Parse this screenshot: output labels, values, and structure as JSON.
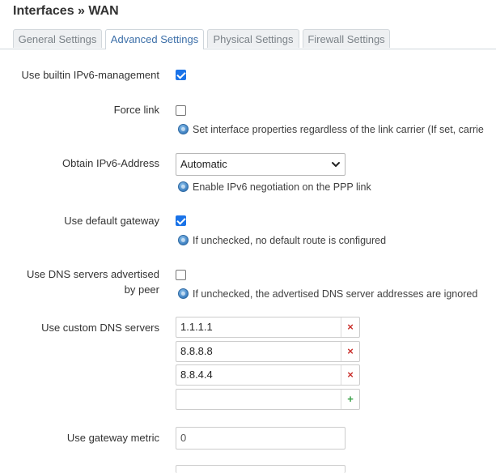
{
  "header": {
    "title": "Interfaces » WAN"
  },
  "tabs": [
    {
      "label": "General Settings",
      "active": false
    },
    {
      "label": "Advanced Settings",
      "active": true
    },
    {
      "label": "Physical Settings",
      "active": false
    },
    {
      "label": "Firewall Settings",
      "active": false
    }
  ],
  "fields": {
    "ipv6_mgmt": {
      "label": "Use builtin IPv6-management",
      "checked": true
    },
    "force_link": {
      "label": "Force link",
      "checked": false,
      "help": "Set interface properties regardless of the link carrier (If set, carrie"
    },
    "obtain_ipv6": {
      "label": "Obtain IPv6-Address",
      "value": "Automatic",
      "help": "Enable IPv6 negotiation on the PPP link"
    },
    "default_gw": {
      "label": "Use default gateway",
      "checked": true,
      "help": "If unchecked, no default route is configured"
    },
    "peer_dns": {
      "label_line1": "Use DNS servers advertised",
      "label_line2": "by peer",
      "checked": false,
      "help": "If unchecked, the advertised DNS server addresses are ignored"
    },
    "custom_dns": {
      "label": "Use custom DNS servers",
      "servers": [
        "1.1.1.1",
        "8.8.8.8",
        "8.8.4.4"
      ],
      "new_value": "",
      "remove_symbol": "×",
      "add_symbol": "+"
    },
    "gw_metric": {
      "label": "Use gateway metric",
      "value": "0"
    }
  },
  "icons": {
    "help": "info-icon",
    "select": "chevron-down-icon"
  },
  "colors": {
    "accent": "#1a73e8",
    "tab_active_text": "#3c6fa8",
    "remove": "#c9302c",
    "add": "#3aa048"
  }
}
